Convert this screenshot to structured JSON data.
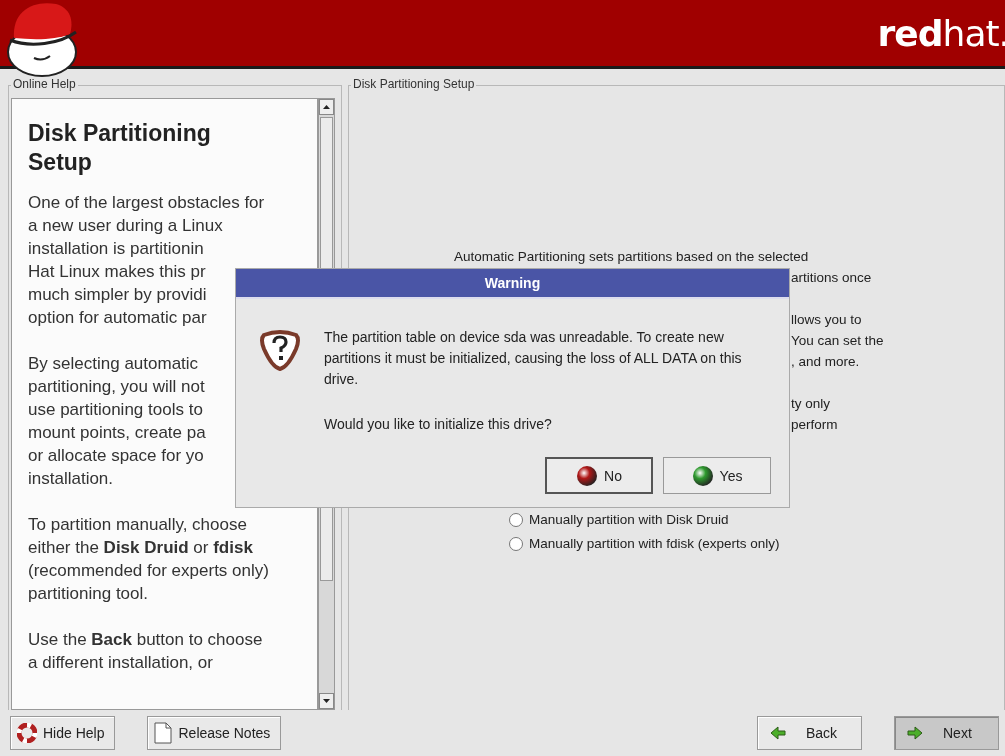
{
  "header": {
    "brand": "**red**hat."
  },
  "help": {
    "title": "Online Help",
    "heading": "Disk Partitioning Setup",
    "paragraphs": [
      [
        "One of the largest obstacles for",
        "a new user during a Linux",
        "installation is partitionin",
        "Hat Linux makes this pr",
        "much simpler by providi",
        "option for automatic par"
      ],
      [
        "By selecting automatic",
        "partitioning, you will not",
        "use partitioning tools to",
        "mount points, create pa",
        "or allocate space for yo",
        "installation."
      ],
      [
        "To partition manually, choose",
        "either the **Disk Druid** or **fdisk**",
        "(recommended for experts only)",
        "partitioning tool."
      ],
      [
        "Use the **Back** button to choose",
        "a different installation, or"
      ]
    ]
  },
  "setup": {
    "title": "Disk Partitioning Setup",
    "groups": [
      [
        {
          "kind": "full",
          "text": "Automatic Partitioning sets partitions based on the selected"
        },
        {
          "kind": "tail",
          "text": "artitions once"
        }
      ],
      [
        {
          "kind": "tail",
          "text": "llows you to"
        },
        {
          "kind": "tail",
          "text": "You can set the"
        },
        {
          "kind": "tail",
          "text": ", and more."
        }
      ],
      [
        {
          "kind": "tail",
          "text": "ty only"
        },
        {
          "kind": "tail",
          "text": "perform"
        }
      ]
    ],
    "options": [
      {
        "label": "Manually partition with Disk Druid",
        "selected": false
      },
      {
        "label": "Manually partition with fdisk (experts only)",
        "selected": false
      }
    ]
  },
  "dialog": {
    "title": "Warning",
    "message": "The partition table on device sda was unreadable. To create new partitions it must be initialized, causing the loss of ALL DATA on this drive.",
    "question": "Would you like to initialize this drive?",
    "buttons": [
      {
        "label": "No",
        "kind": "no",
        "focused": true
      },
      {
        "label": "Yes",
        "kind": "yes",
        "focused": false
      }
    ]
  },
  "footer": {
    "left": [
      {
        "label": "Hide Help",
        "kind": "help"
      },
      {
        "label": "Release Notes",
        "kind": "notes"
      }
    ],
    "right": [
      {
        "label": "Back",
        "kind": "back",
        "pressed": false
      },
      {
        "label": "Next",
        "kind": "next",
        "pressed": true
      }
    ]
  }
}
